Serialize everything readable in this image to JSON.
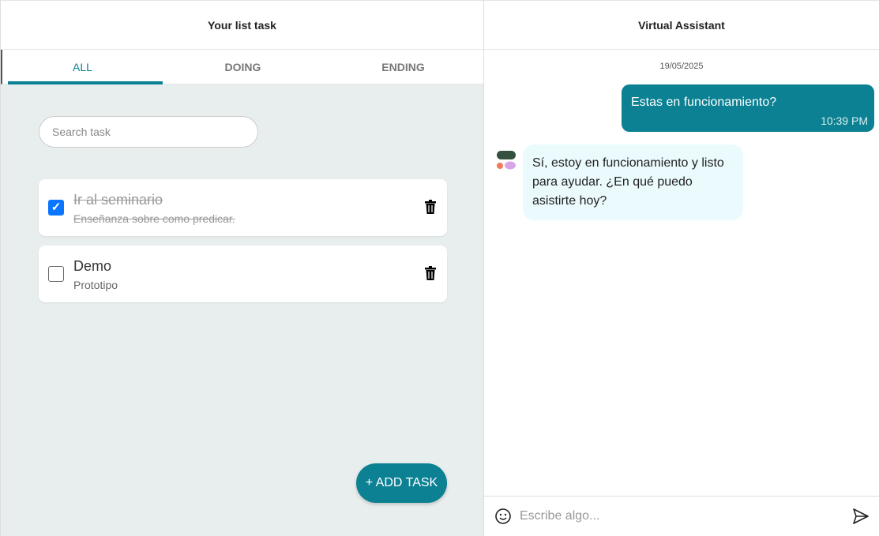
{
  "tasks_panel": {
    "title": "Your list task",
    "tabs": [
      {
        "label": "ALL",
        "active": true
      },
      {
        "label": "DOING",
        "active": false
      },
      {
        "label": "ENDING",
        "active": false
      }
    ],
    "search_placeholder": "Search task",
    "tasks": [
      {
        "title": "Ir al seminario",
        "description": "Enseñanza sobre como predicar.",
        "done": true
      },
      {
        "title": "Demo",
        "description": "Prototipo",
        "done": false
      }
    ],
    "add_label": "+ ADD TASK"
  },
  "assistant": {
    "title": "Virtual Assistant",
    "date": "19/05/2025",
    "messages": [
      {
        "from": "user",
        "text": "Estas en funcionamiento?",
        "time": "10:39 PM"
      },
      {
        "from": "bot",
        "text": "Sí, estoy en funcionamiento y listo para ayudar. ¿En qué puedo asistirte hoy?"
      }
    ],
    "input_placeholder": "Escribe algo..."
  },
  "colors": {
    "accent": "#0b8193",
    "bot_bubble": "#eafafd",
    "checkbox": "#0a75ff",
    "panel_bg": "#e8eeee"
  }
}
